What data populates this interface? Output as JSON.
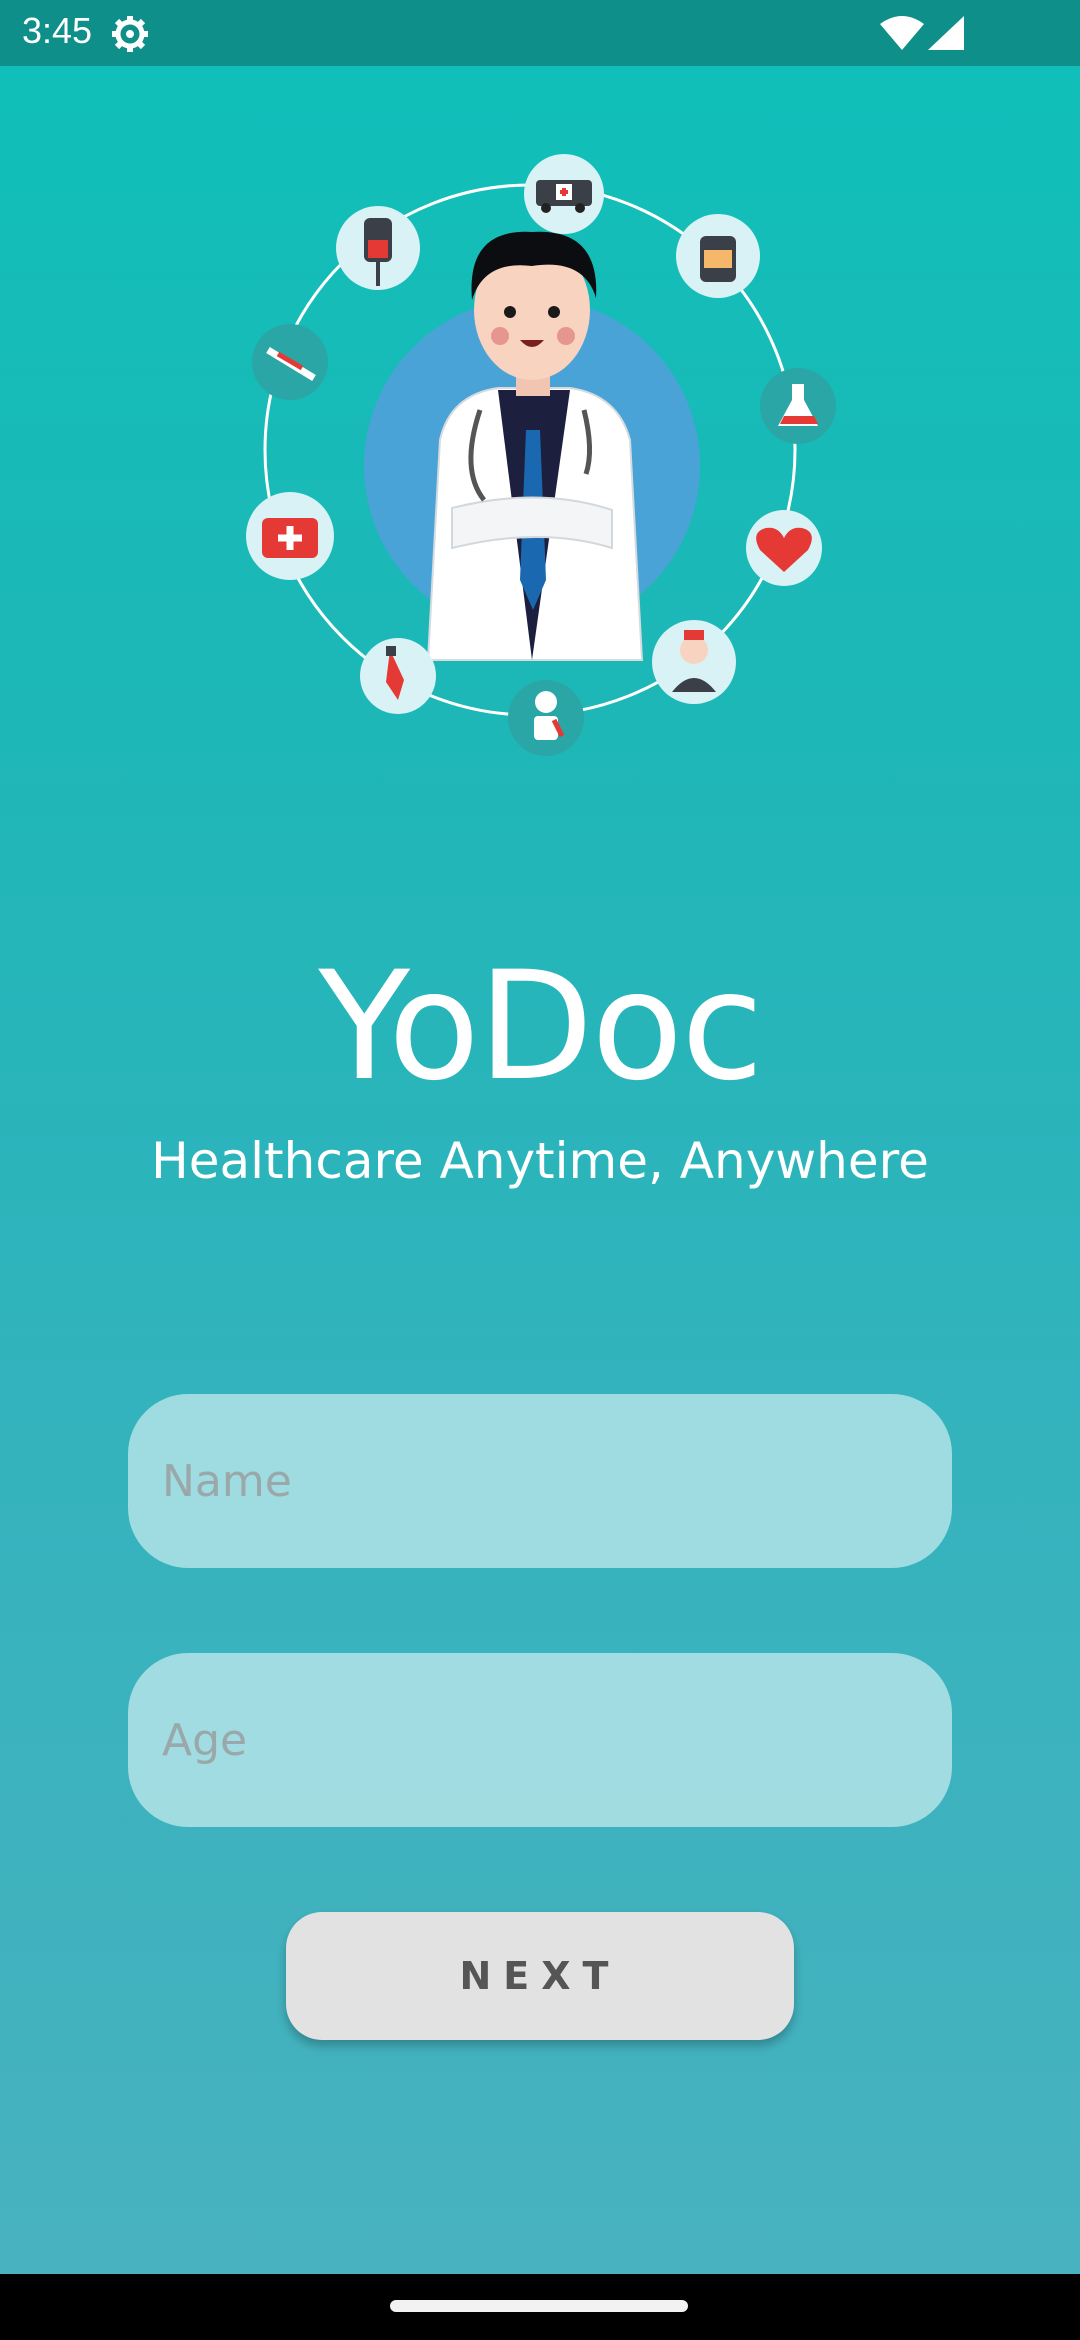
{
  "status_bar": {
    "time": "3:45",
    "icons": [
      "gear-icon",
      "wifi-icon",
      "cell-signal-icon"
    ]
  },
  "illustration": {
    "description_icons": [
      "ambulance-icon",
      "medicine-bottle-icon",
      "flask-icon",
      "heart-icon",
      "nurse-icon",
      "patient-icon",
      "dropper-icon",
      "first-aid-kit-icon",
      "syringe-icon",
      "iv-bag-icon",
      "doctor-illustration"
    ]
  },
  "app": {
    "title": "YoDoc",
    "tagline": "Healthcare Anytime, Anywhere"
  },
  "form": {
    "name_placeholder": "Name",
    "age_placeholder": "Age",
    "next_label": "NEXT"
  },
  "colors": {
    "accent": "#0fc0b9",
    "status_bar": "#0e8f89",
    "field_bg": "#c8ebee",
    "button_bg": "#e2e2e2"
  }
}
